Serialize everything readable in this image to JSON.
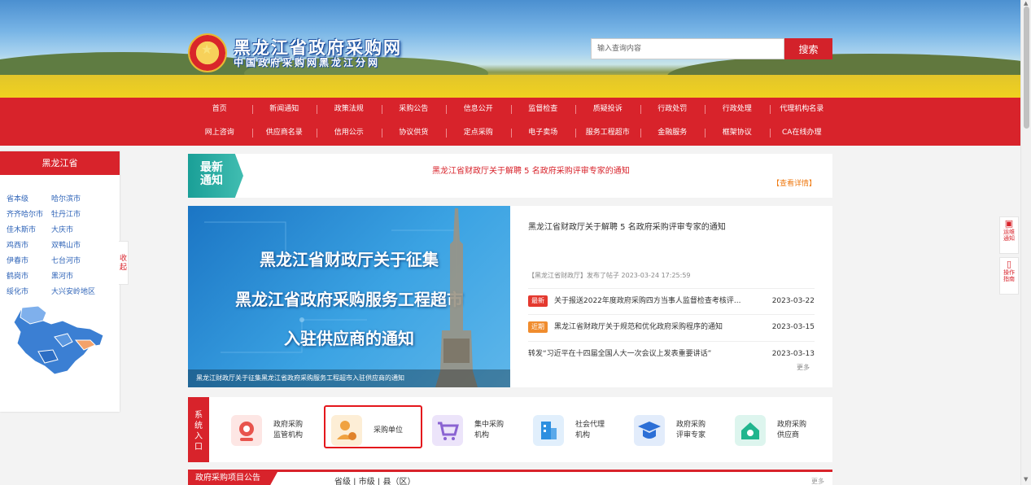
{
  "header": {
    "title": "黑龙江省政府采购网",
    "subtitle": "中国政府采购网黑龙江分网",
    "search_placeholder": "输入查询内容",
    "search_label": "搜索"
  },
  "nav_row1": [
    "首页",
    "新闻通知",
    "政策法规",
    "采购公告",
    "信息公开",
    "监督检查",
    "质疑投诉",
    "行政处罚",
    "行政处理",
    "代理机构名录"
  ],
  "nav_row2": [
    "网上咨询",
    "供应商名录",
    "信用公示",
    "协议供货",
    "定点采购",
    "电子卖场",
    "服务工程超市",
    "金融服务",
    "框架协议",
    "CA在线办理"
  ],
  "region": {
    "title": "黑龙江省",
    "items": [
      "省本级",
      "哈尔滨市",
      "齐齐哈尔市",
      "牡丹江市",
      "佳木斯市",
      "大庆市",
      "鸡西市",
      "双鸭山市",
      "伊春市",
      "七台河市",
      "鹤岗市",
      "黑河市",
      "绥化市",
      "大兴安岭地区"
    ],
    "collapse": "收起"
  },
  "notice": {
    "badge": "最新通知",
    "text": "黑龙江省财政厅关于解聘 5 名政府采购评审专家的通知",
    "more": "【查看详情】"
  },
  "hero": {
    "lines": [
      "黑龙江省财政厅关于征集",
      "黑龙江省政府采购服务工程超市",
      "入驻供应商的通知"
    ],
    "caption": "黑龙江财政厅关于征集黑龙江省政府采购服务工程超市入驻供应商的通知"
  },
  "headlines": {
    "title": "黑龙江省财政厅关于解聘 5 名政府采购评审专家的通知",
    "meta": "【黑龙江省财政厅】发布了帖子  2023-03-24 17:25:59",
    "items": [
      {
        "tag": "最新",
        "text": "关于报送2022年度政府采购四方当事人监督检查考核评...",
        "date": "2023-03-22"
      },
      {
        "tag": "近期",
        "text": "黑龙江省财政厅关于规范和优化政府采购程序的通知",
        "date": "2023-03-15"
      },
      {
        "tag": "",
        "text": "转发“习近平在十四届全国人大一次会议上发表重要讲话”",
        "date": "2023-03-13"
      }
    ],
    "more": "更多"
  },
  "entry": {
    "label": "系统入口",
    "items": [
      {
        "line1": "政府采购",
        "line2": "监管机构",
        "icon": "monitor-icon",
        "color": "#e8544d"
      },
      {
        "line1": "采购单位",
        "line2": "",
        "icon": "person-icon",
        "color": "#f0a240"
      },
      {
        "line1": "集中采购",
        "line2": "机构",
        "icon": "cart-icon",
        "color": "#8a63d2"
      },
      {
        "line1": "社会代理",
        "line2": "机构",
        "icon": "building-icon",
        "color": "#2d8fe0"
      },
      {
        "line1": "政府采购",
        "line2": "评审专家",
        "icon": "graduate-icon",
        "color": "#2c6fd6"
      },
      {
        "line1": "政府采购",
        "line2": "供应商",
        "icon": "home-icon",
        "color": "#21b58e"
      }
    ]
  },
  "projects": {
    "title": "政府采购项目公告",
    "tabs": "省级  |  市级  |  县（区）",
    "more": "更多"
  },
  "float_tools": [
    {
      "label": "运维通知",
      "icon": "bell-icon"
    },
    {
      "label": "操作指南",
      "icon": "book-icon"
    }
  ],
  "colors": {
    "brand_red": "#d8232b",
    "notice_teal": "#1a9f97",
    "link_blue": "#2f64b8",
    "tag_new": "#e4392f",
    "tag_recent": "#f08c2e"
  }
}
